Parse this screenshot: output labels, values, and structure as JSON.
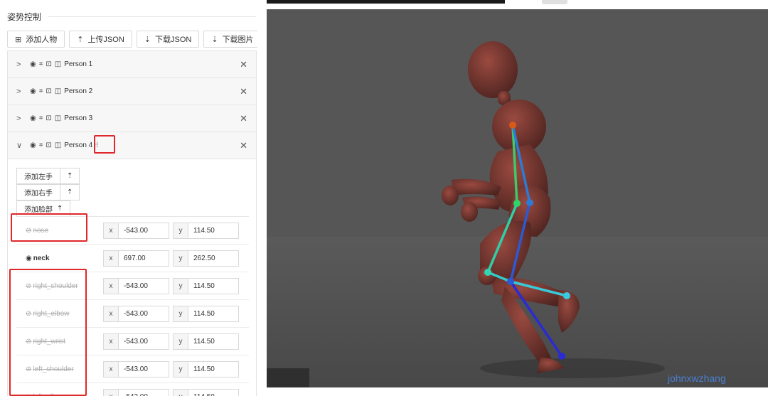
{
  "panel": {
    "title": "姿势控制"
  },
  "toolbar": {
    "add_person": "添加人物",
    "upload_json": "上传JSON",
    "download_json": "下载JSON",
    "download_image": "下载图片"
  },
  "persons": [
    {
      "name": "Person 1",
      "expanded": false
    },
    {
      "name": "Person 2",
      "expanded": false
    },
    {
      "name": "Person 3",
      "expanded": false
    },
    {
      "name": "Person 4",
      "expanded": true
    }
  ],
  "person_toolbar_icons": [
    "eye-icon",
    "focus-icon",
    "unlock-icon",
    "mirror-icon"
  ],
  "expanded_person": {
    "add_left_hand": "添加左手",
    "add_right_hand": "添加右手",
    "add_face": "添加脸部",
    "keypoints": [
      {
        "name": "nose",
        "visible": false,
        "x": "-543.00",
        "y": "114.50"
      },
      {
        "name": "neck",
        "visible": true,
        "x": "697.00",
        "y": "262.50"
      },
      {
        "name": "right_shoulder",
        "visible": false,
        "x": "-543.00",
        "y": "114.50"
      },
      {
        "name": "right_elbow",
        "visible": false,
        "x": "-543.00",
        "y": "114.50"
      },
      {
        "name": "right_wrist",
        "visible": false,
        "x": "-543.00",
        "y": "114.50"
      },
      {
        "name": "left_shoulder",
        "visible": false,
        "x": "-543.00",
        "y": "114.50"
      },
      {
        "name": "left_elbow",
        "visible": false,
        "x": "-543.00",
        "y": "114.50"
      }
    ],
    "x_label": "x",
    "y_label": "y"
  },
  "watermark": "johnxwzhang",
  "colors": {
    "highlight": "#e0272b",
    "viewport_bg": "#565656",
    "mannequin": "#7a3a32"
  }
}
